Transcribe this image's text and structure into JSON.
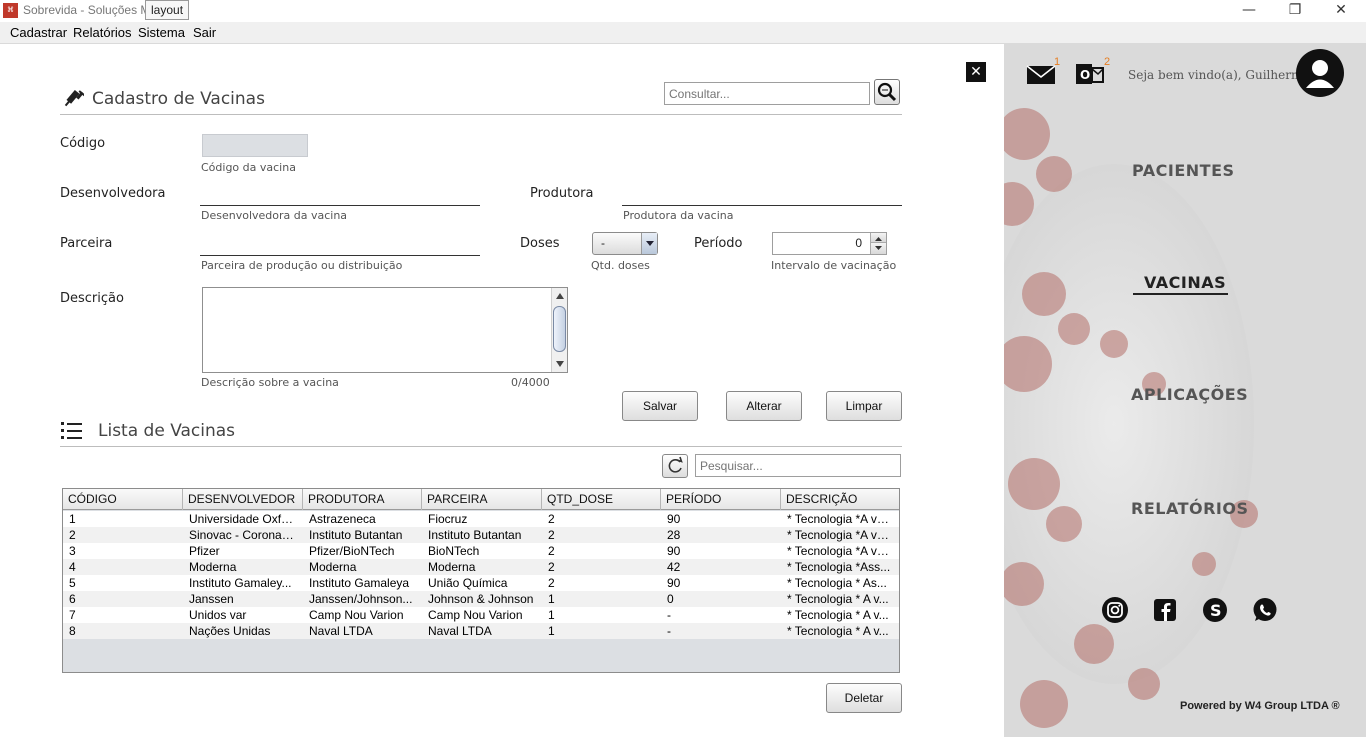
{
  "window": {
    "title": "Sobrevida - Soluções M",
    "tooltip": "layout",
    "minimize": "—",
    "maximize": "❐",
    "close": "✕"
  },
  "menu": [
    "Cadastrar",
    "Relatórios",
    "Sistema",
    "Sair"
  ],
  "form": {
    "title": "Cadastro de Vacinas",
    "search_placeholder": "Consultar...",
    "close_label": "✕",
    "codigo_label": "Código",
    "codigo_hint": "Código da vacina",
    "desenvolvedora_label": "Desenvolvedora",
    "desenvolvedora_hint": "Desenvolvedora da vacina",
    "produtora_label": "Produtora",
    "produtora_hint": "Produtora da vacina",
    "parceira_label": "Parceira",
    "parceira_hint": "Parceira de produção ou distribuição",
    "doses_label": "Doses",
    "doses_value": "-",
    "doses_hint": "Qtd. doses",
    "periodo_label": "Período",
    "periodo_value": "0",
    "periodo_hint": "Intervalo de vacinação",
    "descricao_label": "Descrição",
    "descricao_hint": "Descrição sobre a vacina",
    "descricao_counter": "0/4000",
    "salvar": "Salvar",
    "alterar": "Alterar",
    "limpar": "Limpar"
  },
  "list": {
    "title": "Lista de Vacinas",
    "search_placeholder": "Pesquisar...",
    "columns": [
      "CÓDIGO",
      "DESENVOLVEDOR",
      "PRODUTORA",
      "PARCEIRA",
      "QTD_DOSE",
      "PERÍODO",
      "DESCRIÇÃO"
    ],
    "rows": [
      [
        "1",
        "Universidade Oxfo...",
        "Astrazeneca",
        "Fiocruz",
        "2",
        "90",
        "* Tecnologia *A va..."
      ],
      [
        "2",
        "Sinovac - CoronaV...",
        "Instituto Butantan",
        "Instituto Butantan",
        "2",
        "28",
        "* Tecnologia *A va..."
      ],
      [
        "3",
        "Pfizer",
        "Pfizer/BioNTech",
        "BioNTech",
        "2",
        "90",
        "* Tecnologia *A va..."
      ],
      [
        "4",
        "Moderna",
        "Moderna",
        "Moderna",
        "2",
        "42",
        "* Tecnologia *Ass..."
      ],
      [
        "5",
        "Instituto Gamaley...",
        "Instituto Gamaleya",
        "União Química",
        "2",
        "90",
        "* Tecnologia * As..."
      ],
      [
        "6",
        "Janssen",
        "Janssen/Johnson...",
        "Johnson & Johnson",
        "1",
        "0",
        "* Tecnologia * A v..."
      ],
      [
        "7",
        "Unidos var",
        "Camp Nou Varion",
        "Camp Nou Varion",
        "1",
        "-",
        "* Tecnologia * A v..."
      ],
      [
        "8",
        "Nações Unidas",
        "Naval LTDA",
        "Naval LTDA",
        "1",
        "-",
        "* Tecnologia *  A v..."
      ]
    ],
    "deletar": "Deletar"
  },
  "side": {
    "mail_badge": "1",
    "outlook_badge": "2",
    "welcome": "Seja bem vindo(a), Guilherme!",
    "nav": [
      "PACIENTES",
      "VACINAS",
      "APLICAÇÕES",
      "RELATÓRIOS"
    ],
    "powered_by": "Powered by W4 Group LTDA ®"
  }
}
